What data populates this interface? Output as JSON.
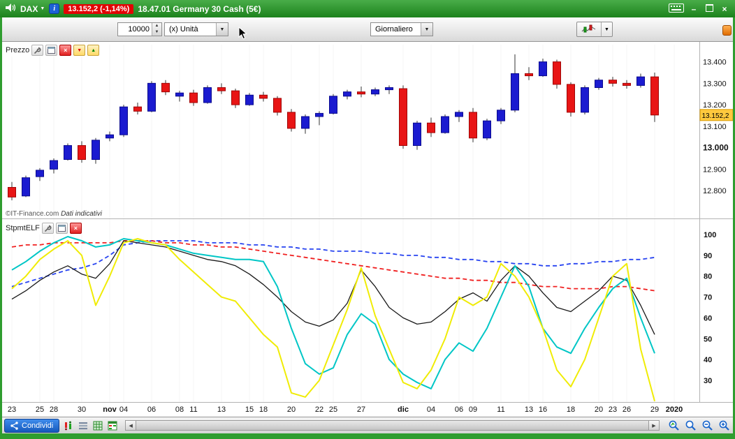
{
  "titlebar": {
    "instrument": "DAX",
    "info_glyph": "i",
    "price_badge": "13.152,2 (-1,14%)",
    "session_info": "18.47.01 Germany 30 Cash (5€)"
  },
  "toolbar": {
    "quantity": "10000",
    "unit_selector": "(x) Unità",
    "timeframe_selector": "Giornaliero"
  },
  "panels": {
    "price_label": "Prezzo",
    "indicator_label": "StpmtELF",
    "watermark_left": "©IT-Finance.com",
    "watermark_right": "Dati indicativi"
  },
  "statusbar": {
    "share_button": "Condividi"
  },
  "icons": {
    "caret_down": "▼",
    "spinner_up": "▲",
    "spinner_down": "▼",
    "scroll_left": "◀",
    "scroll_right": "▶",
    "minimize": "–",
    "close": "×",
    "panel_close": "×",
    "panel_down": "▼",
    "panel_up": "▲"
  },
  "chart_data": {
    "type": "candlestick",
    "title": "Germany 30 Cash (5€) — Giornaliero",
    "last_price": 13152.2,
    "change_pct": -1.14,
    "colors": {
      "bull": "#1b1bd0",
      "bear": "#e81515",
      "wick": "#333333",
      "tag_bg": "#ffc93e",
      "tag_border": "#d99a00"
    },
    "price_axis": {
      "range": [
        12680,
        13480
      ],
      "ticks": [
        {
          "value": 13400,
          "label": "13.400"
        },
        {
          "value": 13300,
          "label": "13.300"
        },
        {
          "value": 13200,
          "label": "13.200"
        },
        {
          "value": 13100,
          "label": "13.100"
        },
        {
          "value": 13000,
          "label": "13.000",
          "bold": true
        },
        {
          "value": 12900,
          "label": "12.900"
        },
        {
          "value": 12800,
          "label": "12.800"
        }
      ],
      "current": {
        "value": 13152.2,
        "label": "13.152,2"
      }
    },
    "x_ticks": [
      {
        "i": 0,
        "l": "23"
      },
      {
        "i": 2,
        "l": "25"
      },
      {
        "i": 3,
        "l": "28"
      },
      {
        "i": 5,
        "l": "30"
      },
      {
        "i": 7,
        "l": "nov",
        "b": 1
      },
      {
        "i": 8,
        "l": "04"
      },
      {
        "i": 10,
        "l": "06"
      },
      {
        "i": 12,
        "l": "08"
      },
      {
        "i": 13,
        "l": "11"
      },
      {
        "i": 15,
        "l": "13"
      },
      {
        "i": 17,
        "l": "15"
      },
      {
        "i": 18,
        "l": "18"
      },
      {
        "i": 20,
        "l": "20"
      },
      {
        "i": 22,
        "l": "22"
      },
      {
        "i": 23,
        "l": "25"
      },
      {
        "i": 25,
        "l": "27"
      },
      {
        "i": 28,
        "l": "dic",
        "b": 1
      },
      {
        "i": 30,
        "l": "04"
      },
      {
        "i": 32,
        "l": "06"
      },
      {
        "i": 33,
        "l": "09"
      },
      {
        "i": 35,
        "l": "11"
      },
      {
        "i": 37,
        "l": "13"
      },
      {
        "i": 38,
        "l": "16"
      },
      {
        "i": 40,
        "l": "18"
      },
      {
        "i": 42,
        "l": "20"
      },
      {
        "i": 43,
        "l": "23"
      },
      {
        "i": 44,
        "l": "26"
      },
      {
        "i": 46,
        "l": "29"
      },
      {
        "i": 47.4,
        "l": "2020",
        "b": 1
      }
    ],
    "candles": [
      [
        12815,
        12840,
        12755,
        12770
      ],
      [
        12775,
        12870,
        12770,
        12860
      ],
      [
        12865,
        12905,
        12845,
        12895
      ],
      [
        12900,
        12950,
        12880,
        12940
      ],
      [
        12945,
        13020,
        12940,
        13010
      ],
      [
        13010,
        13030,
        12930,
        12945
      ],
      [
        12945,
        13045,
        12925,
        13035
      ],
      [
        13045,
        13075,
        13030,
        13060
      ],
      [
        13060,
        13200,
        13050,
        13190
      ],
      [
        13190,
        13210,
        13155,
        13170
      ],
      [
        13170,
        13310,
        13165,
        13300
      ],
      [
        13300,
        13315,
        13245,
        13260
      ],
      [
        13240,
        13265,
        13215,
        13255
      ],
      [
        13255,
        13270,
        13195,
        13210
      ],
      [
        13210,
        13290,
        13205,
        13280
      ],
      [
        13280,
        13300,
        13250,
        13265
      ],
      [
        13265,
        13275,
        13185,
        13200
      ],
      [
        13200,
        13255,
        13195,
        13245
      ],
      [
        13245,
        13260,
        13215,
        13230
      ],
      [
        13230,
        13240,
        13150,
        13165
      ],
      [
        13165,
        13180,
        13075,
        13090
      ],
      [
        13090,
        13155,
        13065,
        13145
      ],
      [
        13145,
        13170,
        13105,
        13160
      ],
      [
        13160,
        13250,
        13155,
        13240
      ],
      [
        13240,
        13270,
        13225,
        13260
      ],
      [
        13260,
        13285,
        13235,
        13250
      ],
      [
        13250,
        13280,
        13240,
        13270
      ],
      [
        13270,
        13290,
        13250,
        13280
      ],
      [
        13275,
        13290,
        12995,
        13010
      ],
      [
        13010,
        13125,
        12990,
        13115
      ],
      [
        13115,
        13140,
        13050,
        13070
      ],
      [
        13070,
        13155,
        13065,
        13145
      ],
      [
        13145,
        13175,
        13120,
        13165
      ],
      [
        13165,
        13185,
        13025,
        13045
      ],
      [
        13045,
        13135,
        13035,
        13125
      ],
      [
        13125,
        13185,
        13110,
        13175
      ],
      [
        13175,
        13435,
        13165,
        13345
      ],
      [
        13345,
        13375,
        13315,
        13335
      ],
      [
        13335,
        13415,
        13330,
        13400
      ],
      [
        13400,
        13410,
        13275,
        13295
      ],
      [
        13295,
        13305,
        13145,
        13165
      ],
      [
        13165,
        13290,
        13155,
        13280
      ],
      [
        13280,
        13325,
        13270,
        13315
      ],
      [
        13315,
        13330,
        13285,
        13300
      ],
      [
        13300,
        13315,
        13275,
        13290
      ],
      [
        13290,
        13345,
        13280,
        13330
      ],
      [
        13330,
        13350,
        13120,
        13152.2
      ]
    ],
    "indicator": {
      "name": "StpmtELF",
      "axis_ticks": [
        100,
        90,
        80,
        70,
        60,
        50,
        40,
        30
      ],
      "series": [
        {
          "name": "upper-band",
          "color": "#2743f0",
          "style": "dashed",
          "width": 1.8,
          "values": [
            75,
            77,
            79,
            81,
            83,
            84,
            86,
            90,
            95,
            96,
            97,
            97,
            97,
            97,
            96,
            96,
            96,
            95,
            95,
            94,
            94,
            93,
            93,
            92,
            92,
            92,
            91,
            91,
            90,
            90,
            89,
            89,
            88,
            88,
            87,
            87,
            86,
            86,
            85,
            85,
            86,
            86,
            87,
            87,
            88,
            88,
            89
          ]
        },
        {
          "name": "lower-band",
          "color": "#f02020",
          "style": "dashed",
          "width": 1.8,
          "values": [
            94,
            95,
            95,
            96,
            96,
            96,
            96,
            96,
            97,
            97,
            97,
            96,
            96,
            95,
            95,
            94,
            94,
            93,
            92,
            91,
            90,
            89,
            88,
            87,
            86,
            85,
            84,
            83,
            82,
            81,
            80,
            79,
            79,
            78,
            78,
            77,
            77,
            76,
            75,
            75,
            74,
            74,
            74,
            75,
            75,
            74,
            73
          ]
        },
        {
          "name": "signal",
          "color": "#1a1a1a",
          "style": "solid",
          "width": 1.3,
          "values": [
            69,
            73,
            78,
            82,
            85,
            81,
            79,
            86,
            97,
            96,
            95,
            94,
            92,
            90,
            88,
            87,
            85,
            81,
            76,
            70,
            63,
            58,
            56,
            59,
            67,
            83,
            75,
            65,
            60,
            57,
            58,
            63,
            69,
            72,
            68,
            78,
            85,
            80,
            72,
            65,
            63,
            68,
            73,
            80,
            78,
            66,
            52
          ]
        },
        {
          "name": "k-slow",
          "color": "#00c6c6",
          "style": "solid",
          "width": 2,
          "values": [
            83,
            87,
            92,
            96,
            99,
            97,
            94,
            95,
            98,
            97,
            96,
            95,
            93,
            91,
            90,
            89,
            88,
            88,
            87,
            75,
            55,
            38,
            33,
            36,
            52,
            62,
            57,
            40,
            33,
            29,
            26,
            40,
            48,
            44,
            55,
            70,
            85,
            75,
            55,
            46,
            43,
            55,
            65,
            74,
            79,
            60,
            43
          ]
        },
        {
          "name": "k-fast",
          "color": "#f0ec06",
          "style": "solid",
          "width": 2,
          "values": [
            74,
            80,
            88,
            93,
            97,
            90,
            66,
            80,
            96,
            98,
            96,
            95,
            88,
            82,
            76,
            70,
            68,
            60,
            52,
            46,
            24,
            22,
            30,
            47,
            64,
            84,
            61,
            45,
            29,
            26,
            35,
            50,
            70,
            66,
            70,
            86,
            80,
            70,
            55,
            35,
            27,
            40,
            60,
            80,
            86,
            45,
            20
          ]
        }
      ]
    }
  }
}
